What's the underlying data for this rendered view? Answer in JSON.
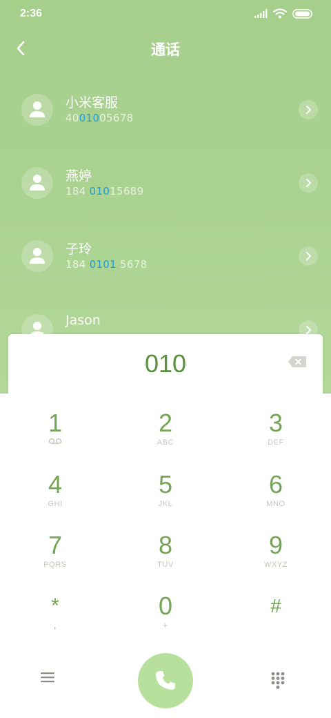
{
  "status_bar": {
    "time": "2:36",
    "icons": [
      "signal-icon",
      "wifi-icon",
      "battery-icon"
    ]
  },
  "header": {
    "title": "通话",
    "back_icon": "chevron-left-icon"
  },
  "contacts": [
    {
      "name": "小米客服",
      "num_pre": "40",
      "num_hl": "010",
      "num_post": "05678"
    },
    {
      "name": "燕婷",
      "num_pre": "184 ",
      "num_hl": "010",
      "num_post": "15689"
    },
    {
      "name": "子玲",
      "num_pre": "184 ",
      "num_hl": "0101",
      "num_post": " 5678"
    },
    {
      "name": "Jason",
      "num_pre": "",
      "num_hl": "",
      "num_post": ""
    }
  ],
  "dialer": {
    "number": "010",
    "backspace_icon": "backspace-icon"
  },
  "keys": [
    {
      "digit": "1",
      "letters": ""
    },
    {
      "digit": "2",
      "letters": "ABC"
    },
    {
      "digit": "3",
      "letters": "DEF"
    },
    {
      "digit": "4",
      "letters": "GHI"
    },
    {
      "digit": "5",
      "letters": "JKL"
    },
    {
      "digit": "6",
      "letters": "MNO"
    },
    {
      "digit": "7",
      "letters": "PQRS"
    },
    {
      "digit": "8",
      "letters": "TUV"
    },
    {
      "digit": "9",
      "letters": "WXYZ"
    },
    {
      "digit": "*",
      "letters": ","
    },
    {
      "digit": "0",
      "letters": "+"
    },
    {
      "digit": "#",
      "letters": ""
    }
  ],
  "bottom_bar": {
    "menu_icon": "menu-icon",
    "call_icon": "phone-icon",
    "keypad_icon": "keypad-grid-icon"
  },
  "colors": {
    "accent_green": "#74a556",
    "background_green": "#a9d190",
    "highlight_blue": "#1e9bd8",
    "call_button": "#b6e09c"
  }
}
